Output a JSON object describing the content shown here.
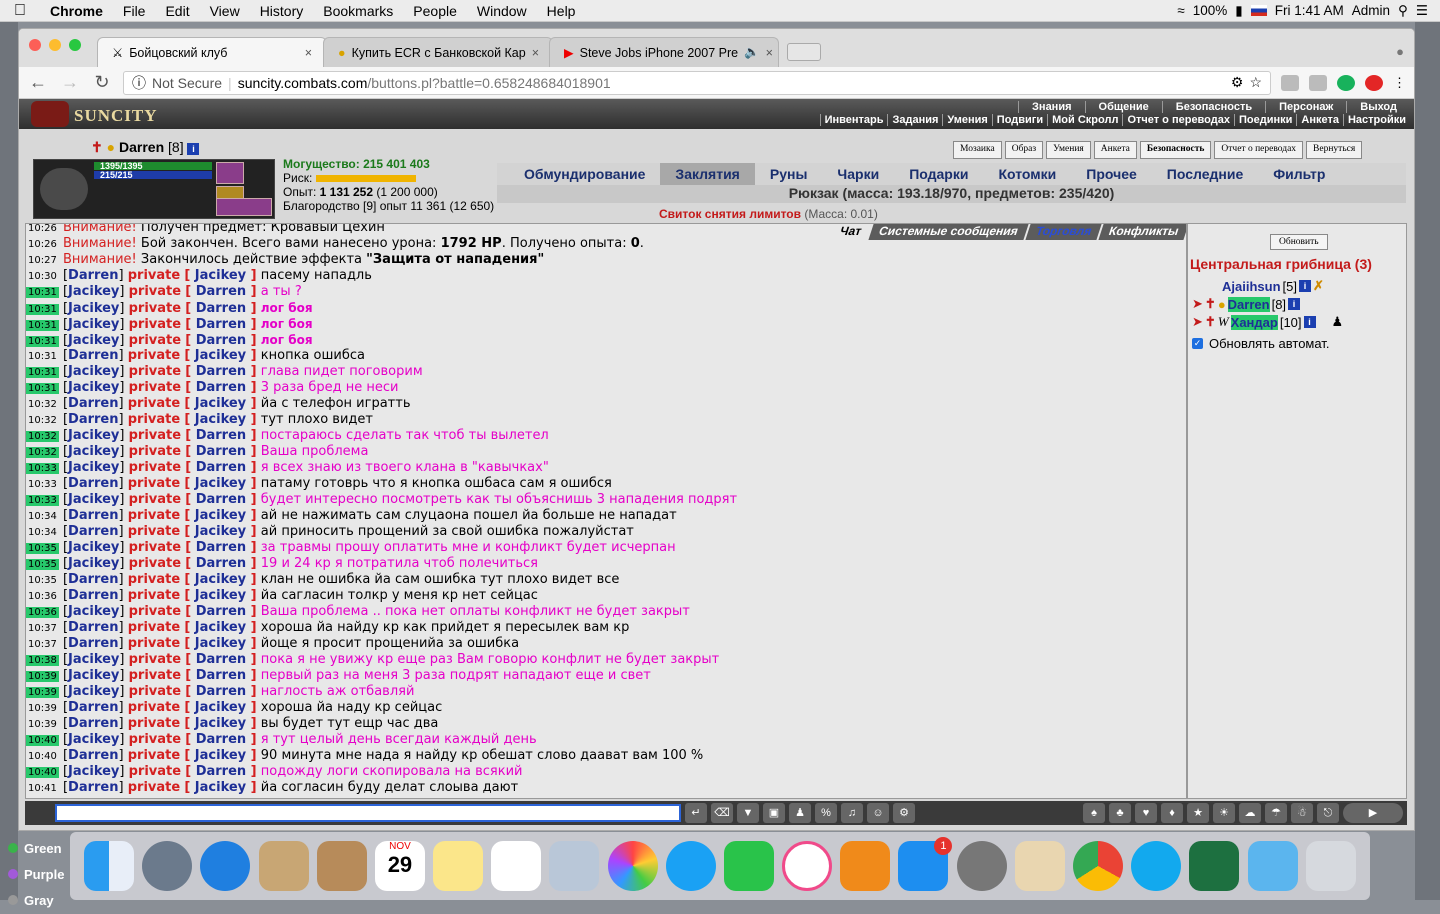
{
  "menubar": {
    "app": "Chrome",
    "items": [
      "File",
      "Edit",
      "View",
      "History",
      "Bookmarks",
      "People",
      "Window",
      "Help"
    ],
    "battery": "100%",
    "clock": "Fri 1:41 AM",
    "user": "Admin"
  },
  "tabs": [
    {
      "title": "Бойцовский клуб",
      "close": "×"
    },
    {
      "title": "Купить ECR с Банковской Кар",
      "close": "×"
    },
    {
      "title": "Steve Jobs iPhone 2007 Pre",
      "close": "×"
    }
  ],
  "address": {
    "security": "Not Secure",
    "domain": "suncity.combats.com",
    "path": "/buttons.pl?battle=0.658248684018901"
  },
  "game": {
    "logo": "SUNCITY",
    "topnav1": [
      "Знания",
      "Общение",
      "Безопасность",
      "Персонаж",
      "Выход"
    ],
    "topnav2": [
      "Инвентарь",
      "Задания",
      "Умения",
      "Подвиги",
      "Мой Скролл",
      "Отчет о переводах",
      "Поединки",
      "Анкета",
      "Настройки"
    ],
    "character": {
      "name": "Darren",
      "level": "[8]",
      "hp": "1395/1395",
      "mana": "215/215",
      "might_label": "Могущество:",
      "might_value": "215 401 403",
      "risk_label": "Риск:",
      "exp_label": "Опыт:",
      "exp_value": "1 131 252",
      "exp_next": "(1 200 000)",
      "nobility": "Благородство [9] опыт 11 361 (12 650)"
    },
    "inv_buttons": [
      "Мозаика",
      "Образ",
      "Умения",
      "Анкета",
      "Безопасность",
      "Отчет о переводах",
      "Вернуться"
    ],
    "inv_tabs": [
      "Обмундирование",
      "Заклятия",
      "Руны",
      "Чарки",
      "Подарки",
      "Котомки",
      "Прочее",
      "Последние",
      "Фильтр"
    ],
    "inv_active": "Заклятия",
    "backpack": "Рюкзак (масса: 193.18/970, предметов: 235/420)",
    "scroll_item": "Свиток снятия лимитов",
    "scroll_mass": "(Масса: 0.01)",
    "chat_tabs": [
      "Чат",
      "Системные сообщения",
      "Торговля",
      "Конфликты"
    ],
    "chat": [
      {
        "t": "10:26",
        "hl": false,
        "kind": "sys",
        "label": "Внимание!",
        "text": "Получен предмет: Кровавый Цехин"
      },
      {
        "t": "10:26",
        "hl": false,
        "kind": "sys",
        "label": "Внимание!",
        "text": "Бой закончен. Всего вами нанесено урона: ",
        "b1": "1792 HP",
        "text2": ". Получено опыта: ",
        "b2": "0",
        "text3": "."
      },
      {
        "t": "10:27",
        "hl": false,
        "kind": "sys",
        "label": "Внимание!",
        "text": "Закончилось действие эффекта ",
        "b1": "\"Защита от нападения\""
      },
      {
        "t": "10:30",
        "hl": false,
        "from": "Darren",
        "to": "Jacikey",
        "msg": "пасему нападль",
        "dir": "out"
      },
      {
        "t": "10:31",
        "hl": true,
        "from": "Jacikey",
        "to": "Darren",
        "msg": "а ты ?",
        "dir": "in"
      },
      {
        "t": "10:31",
        "hl": true,
        "from": "Jacikey",
        "to": "Darren",
        "msg": "лог боя",
        "dir": "log"
      },
      {
        "t": "10:31",
        "hl": true,
        "from": "Jacikey",
        "to": "Darren",
        "msg": "лог боя",
        "dir": "log"
      },
      {
        "t": "10:31",
        "hl": true,
        "from": "Jacikey",
        "to": "Darren",
        "msg": "лог боя",
        "dir": "log"
      },
      {
        "t": "10:31",
        "hl": false,
        "from": "Darren",
        "to": "Jacikey",
        "msg": "кнопка ошибса",
        "dir": "out"
      },
      {
        "t": "10:31",
        "hl": true,
        "from": "Jacikey",
        "to": "Darren",
        "msg": "глава пидет поговорим",
        "dir": "in"
      },
      {
        "t": "10:31",
        "hl": true,
        "from": "Jacikey",
        "to": "Darren",
        "msg": "3 раза бред не неси",
        "dir": "in"
      },
      {
        "t": "10:32",
        "hl": false,
        "from": "Darren",
        "to": "Jacikey",
        "msg": "йа с телефон игратть",
        "dir": "out"
      },
      {
        "t": "10:32",
        "hl": false,
        "from": "Darren",
        "to": "Jacikey",
        "msg": "тут плохо видет",
        "dir": "out"
      },
      {
        "t": "10:32",
        "hl": true,
        "from": "Jacikey",
        "to": "Darren",
        "msg": "постараюсь сделать так чтоб ты вылетел",
        "dir": "in"
      },
      {
        "t": "10:32",
        "hl": true,
        "from": "Jacikey",
        "to": "Darren",
        "msg": "Ваша проблема",
        "dir": "in"
      },
      {
        "t": "10:33",
        "hl": true,
        "from": "Jacikey",
        "to": "Darren",
        "msg": "я всех знаю из твоего клана в \"кавычках\"",
        "dir": "in"
      },
      {
        "t": "10:33",
        "hl": false,
        "from": "Darren",
        "to": "Jacikey",
        "msg": "патаму готоврь что я кнопка ошбаса сам я ошибся",
        "dir": "out"
      },
      {
        "t": "10:33",
        "hl": true,
        "from": "Jacikey",
        "to": "Darren",
        "msg": "будет интересно посмотреть как ты объяснишь 3 нападения подрят",
        "dir": "in"
      },
      {
        "t": "10:34",
        "hl": false,
        "from": "Darren",
        "to": "Jacikey",
        "msg": "ай не нажимать сам слуцаона пошел йа больше не нападат",
        "dir": "out"
      },
      {
        "t": "10:34",
        "hl": false,
        "from": "Darren",
        "to": "Jacikey",
        "msg": "ай приносить прощений за свой ошибка пожалуйстат",
        "dir": "out"
      },
      {
        "t": "10:35",
        "hl": true,
        "from": "Jacikey",
        "to": "Darren",
        "msg": "за травмы прошу оплатить мне и конфликт будет исчерпан",
        "dir": "in"
      },
      {
        "t": "10:35",
        "hl": true,
        "from": "Jacikey",
        "to": "Darren",
        "msg": "19 и 24 кр я потратила чтоб полечиться",
        "dir": "in"
      },
      {
        "t": "10:35",
        "hl": false,
        "from": "Darren",
        "to": "Jacikey",
        "msg": "клан не ошибка йа сам ошибка тут плохо видет все",
        "dir": "out"
      },
      {
        "t": "10:36",
        "hl": false,
        "from": "Darren",
        "to": "Jacikey",
        "msg": "йа сагласин толкр у меня кр нет сейцас",
        "dir": "out"
      },
      {
        "t": "10:36",
        "hl": true,
        "from": "Jacikey",
        "to": "Darren",
        "msg": "Ваша проблема .. пока нет оплаты конфликт не будет закрыт",
        "dir": "in"
      },
      {
        "t": "10:37",
        "hl": false,
        "from": "Darren",
        "to": "Jacikey",
        "msg": "хороша йа найду кр как прийдет я пересылек вам кр",
        "dir": "out"
      },
      {
        "t": "10:37",
        "hl": false,
        "from": "Darren",
        "to": "Jacikey",
        "msg": "йоще я просит прощенийа за ошибка",
        "dir": "out"
      },
      {
        "t": "10:38",
        "hl": true,
        "from": "Jacikey",
        "to": "Darren",
        "msg": "пока я не увижу кр еще раз Вам говорю конфлит не будет закрыт",
        "dir": "in"
      },
      {
        "t": "10:39",
        "hl": true,
        "from": "Jacikey",
        "to": "Darren",
        "msg": "первый раз на меня 3 раза подрят нападают еще и свет",
        "dir": "in"
      },
      {
        "t": "10:39",
        "hl": true,
        "from": "Jacikey",
        "to": "Darren",
        "msg": "наглость аж отбавляй",
        "dir": "in"
      },
      {
        "t": "10:39",
        "hl": false,
        "from": "Darren",
        "to": "Jacikey",
        "msg": "хороша йа наду кр сейцас",
        "dir": "out"
      },
      {
        "t": "10:39",
        "hl": false,
        "from": "Darren",
        "to": "Jacikey",
        "msg": "вы будет тут ещр час два",
        "dir": "out"
      },
      {
        "t": "10:40",
        "hl": true,
        "from": "Jacikey",
        "to": "Darren",
        "msg": "я тут целый день всегдаи каждый день",
        "dir": "in"
      },
      {
        "t": "10:40",
        "hl": false,
        "from": "Darren",
        "to": "Jacikey",
        "msg": "90 минута мне нада я найду кр обешат слово даават вам 100 %",
        "dir": "out"
      },
      {
        "t": "10:40",
        "hl": true,
        "from": "Jacikey",
        "to": "Darren",
        "msg": "подожду логи скопировала на всякий",
        "dir": "in"
      },
      {
        "t": "10:41",
        "hl": false,
        "from": "Darren",
        "to": "Jacikey",
        "msg": "йа согласин буду делат слоыва дают",
        "dir": "out"
      }
    ],
    "private_label": "private",
    "sidebar": {
      "refresh": "Обновить",
      "room": "Центральная грибница (3)",
      "players": [
        {
          "name": "Ajaiihsun",
          "level": "[5]"
        },
        {
          "name": "Darren",
          "level": "[8]"
        },
        {
          "name": "Хандар",
          "level": "[10]"
        }
      ],
      "auto": "Обновлять автомат."
    }
  },
  "desktop": {
    "labels": [
      "Green",
      "Purple",
      "Gray"
    ],
    "calendar_month": "NOV",
    "calendar_day": "29",
    "appstore_badge": "1"
  },
  "colors": {
    "accent_red": "#d42020",
    "player_blue": "#1e2f96",
    "incoming_pink": "#e500c8",
    "highlight_green": "#27c86b"
  }
}
